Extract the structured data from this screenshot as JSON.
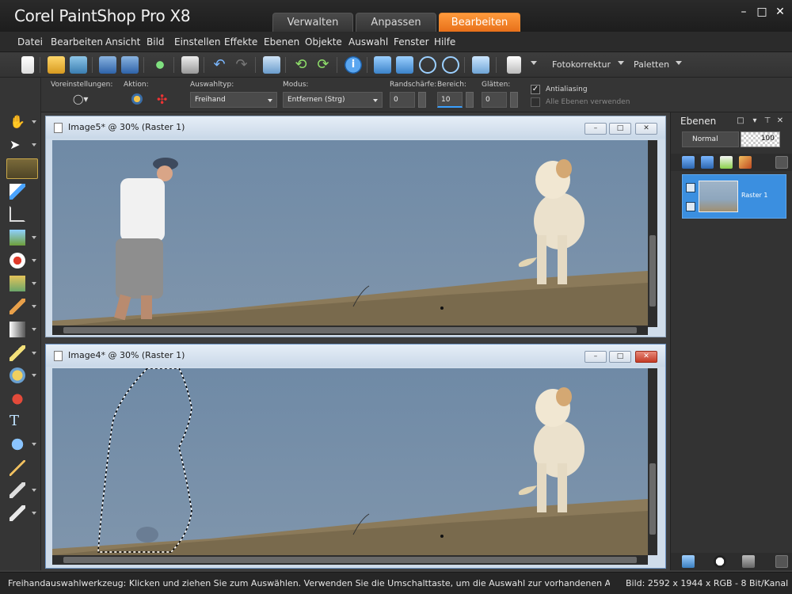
{
  "app": {
    "title": "Corel PaintShop Pro X8",
    "workspace_tabs": [
      {
        "label": "Verwalten",
        "active": false
      },
      {
        "label": "Anpassen",
        "active": false
      },
      {
        "label": "Bearbeiten",
        "active": true
      }
    ],
    "accent_color": "#f08a30"
  },
  "menubar": {
    "items": [
      "Datei",
      "Bearbeiten",
      "Ansicht",
      "Bild",
      "Einstellen",
      "Effekte",
      "Ebenen",
      "Objekte",
      "Auswahl",
      "Fenster",
      "Hilfe"
    ]
  },
  "toolbar": {
    "fotokorrektur_label": "Fotokorrektur",
    "paletten_label": "Paletten"
  },
  "options": {
    "presets_label": "Voreinstellungen:",
    "action_label": "Aktion:",
    "selection_type_label": "Auswahltyp:",
    "selection_type_value": "Freihand",
    "mode_label": "Modus:",
    "mode_value": "Entfernen (Strg)",
    "feather_label": "Randschärfe:",
    "feather_value": "0",
    "range_label": "Bereich:",
    "range_value": "10",
    "smooth_label": "Glätten:",
    "smooth_value": "0",
    "antialias_label": "Antialiasing",
    "antialias_checked": true,
    "all_layers_label": "Alle Ebenen verwenden",
    "all_layers_checked": false
  },
  "documents": [
    {
      "title": "Image5* @  30% (Raster 1)",
      "active": false
    },
    {
      "title": "Image4* @  30% (Raster 1)",
      "active": true
    }
  ],
  "layers_panel": {
    "title": "Ebenen",
    "blend_mode": "Normal",
    "opacity": "100",
    "layer_name": "Raster 1"
  },
  "statusbar": {
    "hint": "Freihandauswahlwerkzeug: Klicken und ziehen Sie zum Auswählen. Verwenden Sie die Umschalttaste, um die Auswahl zur vorhandenen Auswahl hin...",
    "image_info": "Bild:  2592 x 1944 x RGB - 8 Bit/Kanal"
  }
}
